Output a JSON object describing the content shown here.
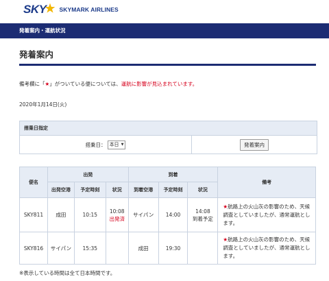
{
  "brand": {
    "logo_text": "SKY",
    "name": "SKYMARK AIRLINES",
    "star_color": "#f2b705",
    "navy": "#1c2c73"
  },
  "breadcrumb": "発着案内・運航状況",
  "page_title": "発着案内",
  "notice": {
    "prefix": "備考欄に「",
    "star": "★",
    "middle": "」がついている便については、",
    "emphasis": "運航に影響が見込まれています。"
  },
  "date": "2020年1月14日(火)",
  "boarding_date": {
    "header": "搭乗日指定",
    "label": "搭乗日：",
    "selected": "本日",
    "button": "発着案内"
  },
  "table": {
    "headers": {
      "flight": "便名",
      "departure": "出発",
      "arrival": "到着",
      "remarks": "備考",
      "dep_airport": "出発空港",
      "dep_sched": "予定時刻",
      "dep_status": "状況",
      "arr_airport": "到着空港",
      "arr_sched": "予定時刻",
      "arr_status": "状況"
    },
    "rows": [
      {
        "flight": "SKY811",
        "dep_airport": "成田",
        "dep_time": "10:15",
        "dep_status_time": "10:08",
        "dep_status": "出発済",
        "arr_airport": "サイパン",
        "arr_time": "14:00",
        "arr_status_time": "14:08",
        "arr_status": "到着予定",
        "remark_star": "★",
        "remark": "航路上の火山灰の影響のため、天候調査としていましたが、通常運航とします。"
      },
      {
        "flight": "SKY816",
        "dep_airport": "サイパン",
        "dep_time": "15:35",
        "dep_status_time": "",
        "dep_status": "",
        "arr_airport": "成田",
        "arr_time": "19:30",
        "arr_status_time": "",
        "arr_status": "",
        "remark_star": "★",
        "remark": "航路上の火山灰の影響のため、天候調査としていましたが、通常運航とします。"
      }
    ]
  },
  "footnote": "※表示している時間は全て日本時間です。"
}
